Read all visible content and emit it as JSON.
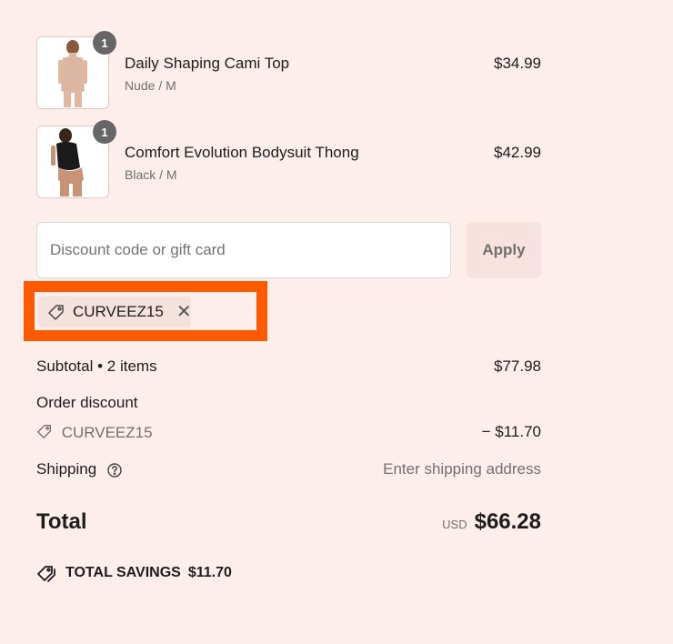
{
  "cart": {
    "items": [
      {
        "name": "Daily Shaping Cami Top",
        "variant": "Nude / M",
        "price": "$34.99",
        "quantity": "1"
      },
      {
        "name": "Comfort Evolution Bodysuit Thong",
        "variant": "Black / M",
        "price": "$42.99",
        "quantity": "1"
      }
    ]
  },
  "discount": {
    "placeholder": "Discount code or gift card",
    "value": "",
    "apply_label": "Apply",
    "applied_code": "CURVEEZ15",
    "remove_icon": "close-icon"
  },
  "summary": {
    "subtotal_label": "Subtotal • 2 items",
    "subtotal_value": "$77.98",
    "order_discount_label": "Order discount",
    "discount_code": "CURVEEZ15",
    "discount_value": "− $11.70",
    "shipping_label": "Shipping",
    "shipping_value": "Enter shipping address",
    "total_label": "Total",
    "currency": "USD",
    "total_value": "$66.28",
    "savings_label": "TOTAL SAVINGS",
    "savings_value": "$11.70"
  },
  "colors": {
    "background": "#fdeeec",
    "highlight_border": "#ff5a00",
    "apply_button_bg": "#f8e2df"
  }
}
